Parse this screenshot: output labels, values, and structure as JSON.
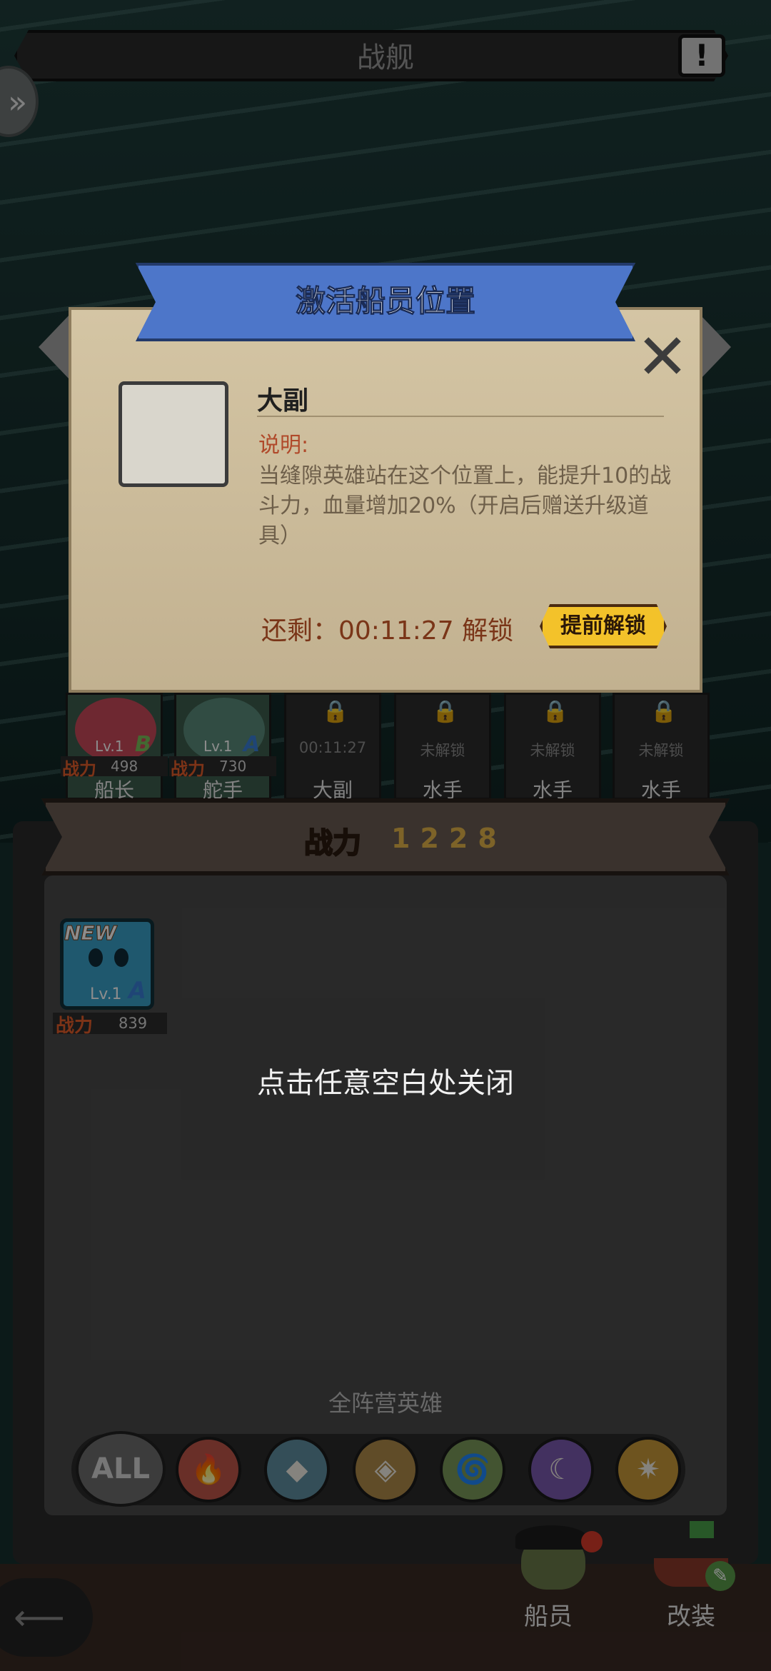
{
  "header": {
    "title": "战舰",
    "info_icon": "!"
  },
  "dialog": {
    "title": "激活船员位置",
    "position_name": "大副",
    "description_label": "说明:",
    "description": "当缝隙英雄站在这个位置上，能提升10的战斗力，血量增加20%（开启后赠送升级道具）",
    "timer": "还剩：00:11:27 解锁",
    "unlock_button": "提前解锁"
  },
  "slots": [
    {
      "role": "船长",
      "level": "Lv.1",
      "grade": "B",
      "power_label": "战力",
      "power": "498"
    },
    {
      "role": "舵手",
      "level": "Lv.1",
      "grade": "A",
      "power_label": "战力",
      "power": "730"
    },
    {
      "role": "大副",
      "status": "00:11:27"
    },
    {
      "role": "水手",
      "status": "未解锁"
    },
    {
      "role": "水手",
      "status": "未解锁"
    },
    {
      "role": "水手",
      "status": "未解锁"
    }
  ],
  "power_banner": {
    "label": "战力",
    "value": "1228"
  },
  "hero_card": {
    "tag": "NEW",
    "level": "Lv.1",
    "grade": "A",
    "power_label": "战力",
    "power": "839"
  },
  "close_hint": "点击任意空白处关闭",
  "faction": {
    "label": "全阵营英雄",
    "all_label": "ALL",
    "filters": [
      {
        "name": "fire",
        "icon": "🔥",
        "color": "#c0564a"
      },
      {
        "name": "ice",
        "icon": "◆",
        "color": "#5f8fa0"
      },
      {
        "name": "earth",
        "icon": "◈",
        "color": "#b08a4a"
      },
      {
        "name": "wind",
        "icon": "🌀",
        "color": "#7a9a5a"
      },
      {
        "name": "moon",
        "icon": "☾",
        "color": "#7a5ab0"
      },
      {
        "name": "light",
        "icon": "✷",
        "color": "#c89a3a"
      }
    ]
  },
  "bottom_nav": {
    "crew": "船员",
    "modify": "改装"
  },
  "colors": {
    "ribbon": "#4d76c9",
    "parchment": "#cfc0a0",
    "power": "#e35d2a",
    "unlock": "#f3c22a"
  }
}
